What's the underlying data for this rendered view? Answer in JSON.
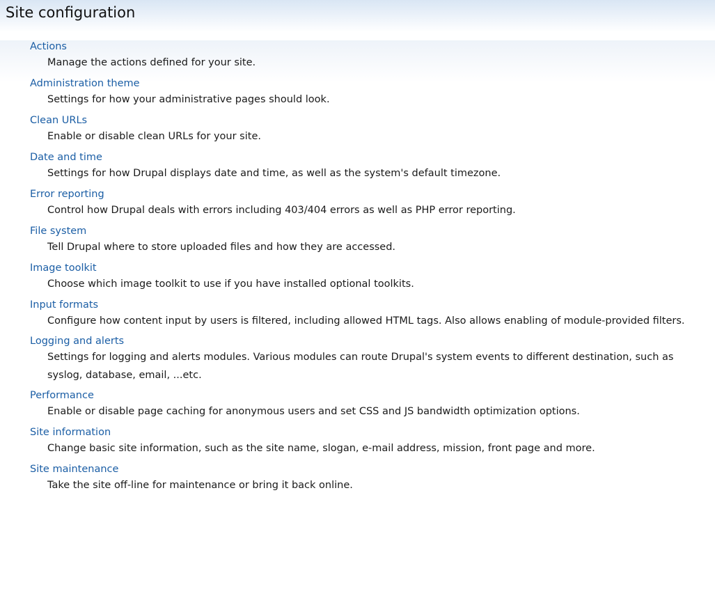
{
  "section": {
    "title": "Site configuration"
  },
  "items": [
    {
      "label": "Actions",
      "description": "Manage the actions defined for your site."
    },
    {
      "label": "Administration theme",
      "description": "Settings for how your administrative pages should look."
    },
    {
      "label": "Clean URLs",
      "description": "Enable or disable clean URLs for your site."
    },
    {
      "label": "Date and time",
      "description": "Settings for how Drupal displays date and time, as well as the system's default timezone."
    },
    {
      "label": "Error reporting",
      "description": "Control how Drupal deals with errors including 403/404 errors as well as PHP error reporting."
    },
    {
      "label": "File system",
      "description": "Tell Drupal where to store uploaded files and how they are accessed."
    },
    {
      "label": "Image toolkit",
      "description": "Choose which image toolkit to use if you have installed optional toolkits."
    },
    {
      "label": "Input formats",
      "description": "Configure how content input by users is filtered, including allowed HTML tags. Also allows enabling of module-provided filters."
    },
    {
      "label": "Logging and alerts",
      "description": "Settings for logging and alerts modules. Various modules can route Drupal's system events to different destination, such as syslog, database, email, ...etc."
    },
    {
      "label": "Performance",
      "description": "Enable or disable page caching for anonymous users and set CSS and JS bandwidth optimization options."
    },
    {
      "label": "Site information",
      "description": "Change basic site information, such as the site name, slogan, e-mail address, mission, front page and more."
    },
    {
      "label": "Site maintenance",
      "description": "Take the site off-line for maintenance or bring it back online."
    }
  ],
  "colors": {
    "link": "#1b5ea5",
    "text": "#1a1a1a",
    "header_gradient_top": "#d9e6f4"
  }
}
